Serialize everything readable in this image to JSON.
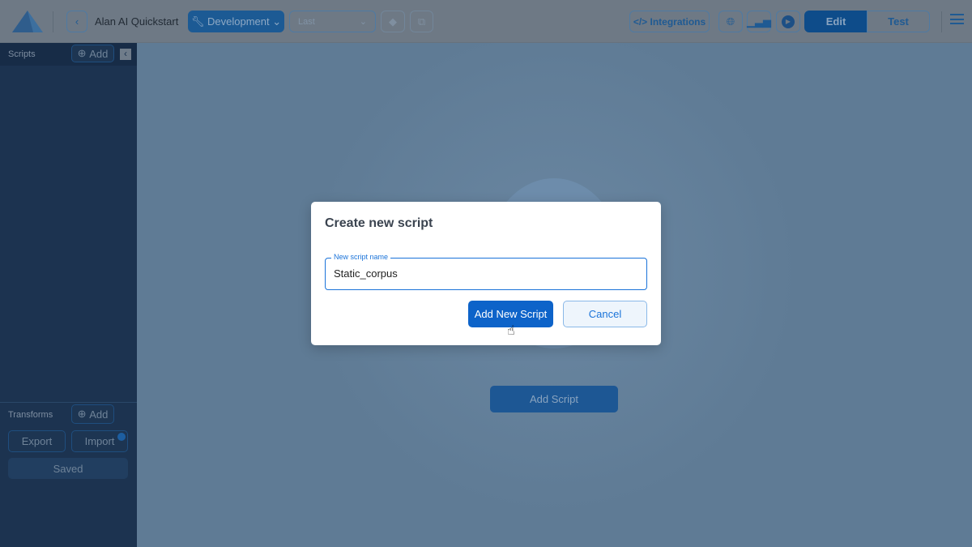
{
  "header": {
    "project_title": "Alan AI Quickstart",
    "environment": "Development",
    "version_placeholder": "Last",
    "integrations": "Integrations",
    "edit": "Edit",
    "test": "Test"
  },
  "sidebar": {
    "scripts_label": "Scripts",
    "add": "Add",
    "transforms_label": "Transforms",
    "transforms_add": "Add",
    "export": "Export",
    "import": "Import",
    "saved": "Saved"
  },
  "main": {
    "add_script": "Add Script"
  },
  "modal": {
    "title": "Create new script",
    "field_label": "New script name",
    "field_value": "Static_corpus",
    "primary": "Add New Script",
    "cancel": "Cancel"
  }
}
